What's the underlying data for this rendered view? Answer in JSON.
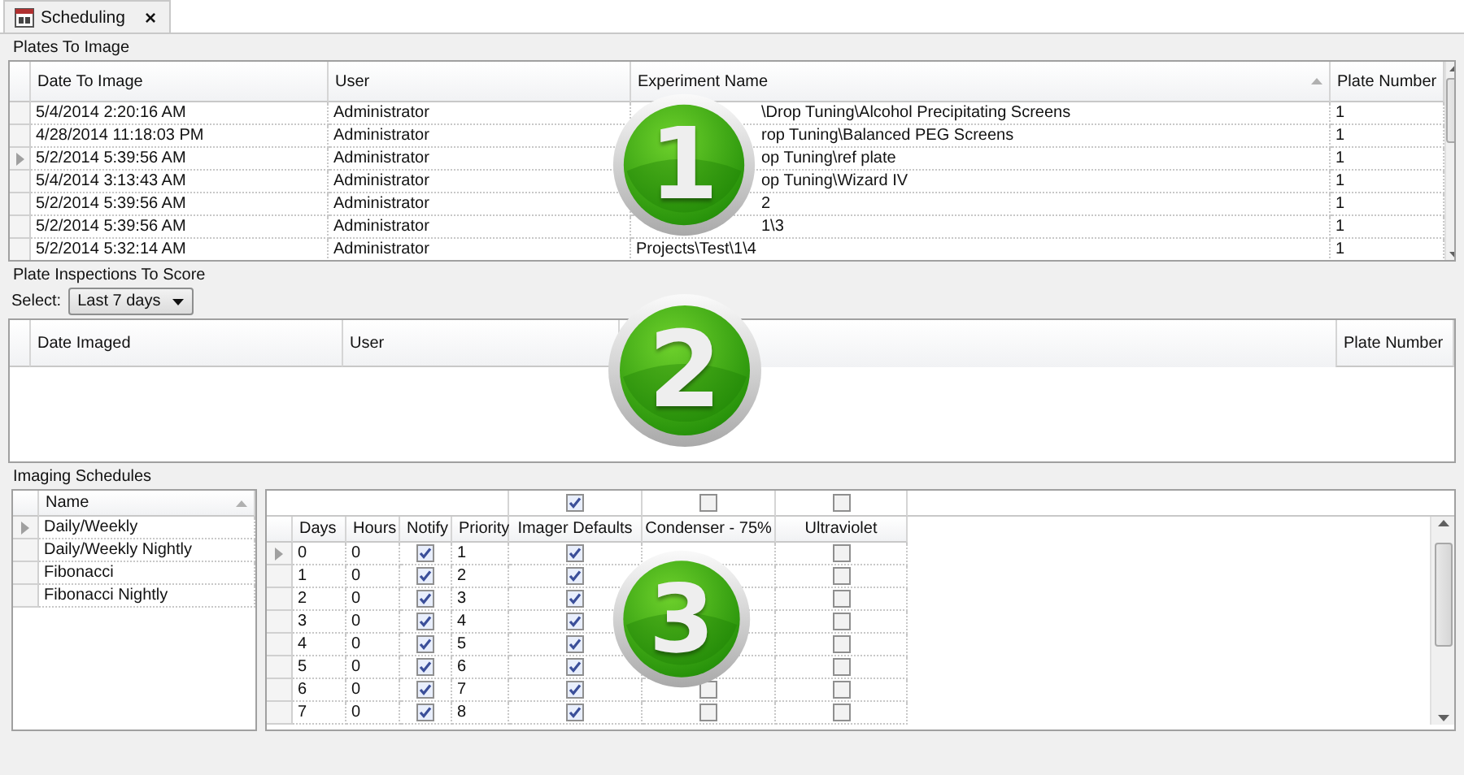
{
  "tab": {
    "title": "Scheduling",
    "close": "×"
  },
  "plates_to_image": {
    "title": "Plates To Image",
    "columns": [
      {
        "label": "Date To Image",
        "sorted": false
      },
      {
        "label": "User",
        "sorted": false
      },
      {
        "label": "Experiment Name",
        "sorted": true
      },
      {
        "label": "Plate Number",
        "sorted": false
      }
    ],
    "rows": [
      {
        "date": "5/4/2014 2:20:16 AM",
        "user": "Administrator",
        "experiment": "\\Drop Tuning\\Alcohol Precipitating Screens",
        "partly_covered": true,
        "plate": "1",
        "selected": false
      },
      {
        "date": "4/28/2014 11:18:03 PM",
        "user": "Administrator",
        "experiment": "rop Tuning\\Balanced PEG Screens",
        "partly_covered": true,
        "plate": "1",
        "selected": false
      },
      {
        "date": "5/2/2014 5:39:56 AM",
        "user": "Administrator",
        "experiment": "op Tuning\\ref plate",
        "partly_covered": true,
        "plate": "1",
        "selected": true
      },
      {
        "date": "5/4/2014 3:13:43 AM",
        "user": "Administrator",
        "experiment": "op Tuning\\Wizard IV",
        "partly_covered": true,
        "plate": "1",
        "selected": false
      },
      {
        "date": "5/2/2014 5:39:56 AM",
        "user": "Administrator",
        "experiment": "2",
        "partly_covered": true,
        "plate": "1",
        "selected": false
      },
      {
        "date": "5/2/2014 5:39:56 AM",
        "user": "Administrator",
        "experiment": "1\\3",
        "partly_covered": true,
        "plate": "1",
        "selected": false
      },
      {
        "date": "5/2/2014 5:32:14 AM",
        "user": "Administrator",
        "experiment": "Projects\\Test\\1\\4",
        "partly_covered": false,
        "plate": "1",
        "selected": false
      }
    ]
  },
  "inspections": {
    "title": "Plate Inspections To Score",
    "select_label": "Select:",
    "select_value": "Last 7 days",
    "columns": [
      {
        "kind": "text",
        "label": "Date Imaged"
      },
      {
        "kind": "text",
        "label": "User"
      },
      {
        "kind": "covered"
      },
      {
        "kind": "text",
        "label": "Plate Number"
      }
    ]
  },
  "schedules": {
    "title": "Imaging Schedules",
    "name_column": {
      "label": "Name",
      "sorted": true
    },
    "items": [
      {
        "name": "Daily/Weekly",
        "selected": true
      },
      {
        "name": "Daily/Weekly Nightly",
        "selected": false
      },
      {
        "name": "Fibonacci",
        "selected": false
      },
      {
        "name": "Fibonacci Nightly",
        "selected": false
      }
    ],
    "imager_toggles": [
      {
        "checked": true
      },
      {
        "checked": false
      },
      {
        "checked": false
      }
    ],
    "columns": [
      "Days",
      "Hours",
      "Notify",
      "Priority",
      "Imager Defaults",
      "Condenser - 75%",
      "Ultraviolet"
    ],
    "rows": [
      {
        "days": "0",
        "hours": "0",
        "notify": true,
        "priority": "1",
        "imager_defaults": true,
        "condenser": null,
        "ultraviolet": false,
        "selected": true
      },
      {
        "days": "1",
        "hours": "0",
        "notify": true,
        "priority": "2",
        "imager_defaults": true,
        "condenser": null,
        "ultraviolet": false,
        "selected": false
      },
      {
        "days": "2",
        "hours": "0",
        "notify": true,
        "priority": "3",
        "imager_defaults": true,
        "condenser": null,
        "ultraviolet": false,
        "selected": false
      },
      {
        "days": "3",
        "hours": "0",
        "notify": true,
        "priority": "4",
        "imager_defaults": true,
        "condenser": null,
        "ultraviolet": false,
        "selected": false
      },
      {
        "days": "4",
        "hours": "0",
        "notify": true,
        "priority": "5",
        "imager_defaults": true,
        "condenser": null,
        "ultraviolet": false,
        "selected": false
      },
      {
        "days": "5",
        "hours": "0",
        "notify": true,
        "priority": "6",
        "imager_defaults": true,
        "condenser": null,
        "ultraviolet": false,
        "selected": false
      },
      {
        "days": "6",
        "hours": "0",
        "notify": true,
        "priority": "7",
        "imager_defaults": true,
        "condenser": false,
        "ultraviolet": false,
        "selected": false
      },
      {
        "days": "7",
        "hours": "0",
        "notify": true,
        "priority": "8",
        "imager_defaults": true,
        "condenser": false,
        "ultraviolet": false,
        "selected": false
      }
    ]
  },
  "badges": [
    {
      "label": "1"
    },
    {
      "label": "2"
    },
    {
      "label": "3"
    }
  ]
}
